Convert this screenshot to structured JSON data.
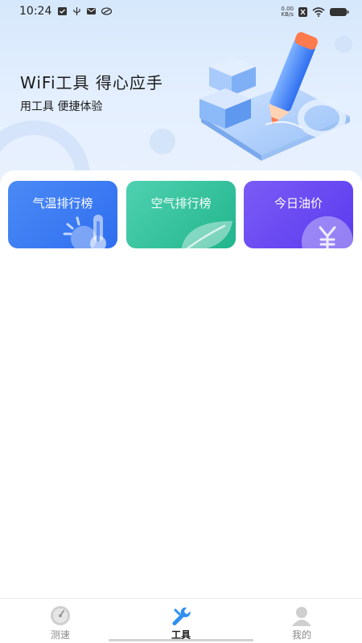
{
  "status_bar": {
    "time": "10:24",
    "net_speed_value": "0.00",
    "net_speed_unit": "KB/s"
  },
  "hero": {
    "title": "WiFi工具 得心应手",
    "subtitle": "用工具 便捷体验"
  },
  "tools": [
    {
      "label": "气温排行榜",
      "icon": "thermometer-sun-icon",
      "color": "#3a78f2"
    },
    {
      "label": "空气排行榜",
      "icon": "leaf-icon",
      "color": "#2cbf98"
    },
    {
      "label": "今日油价",
      "icon": "yuan-coin-icon",
      "color": "#6a4af2"
    }
  ],
  "nav": {
    "items": [
      {
        "label": "测速",
        "icon": "speedometer-icon"
      },
      {
        "label": "工具",
        "icon": "wrench-icon"
      },
      {
        "label": "我的",
        "icon": "user-icon"
      }
    ],
    "active_label": "工具",
    "active_color": "#2f8ff0"
  }
}
